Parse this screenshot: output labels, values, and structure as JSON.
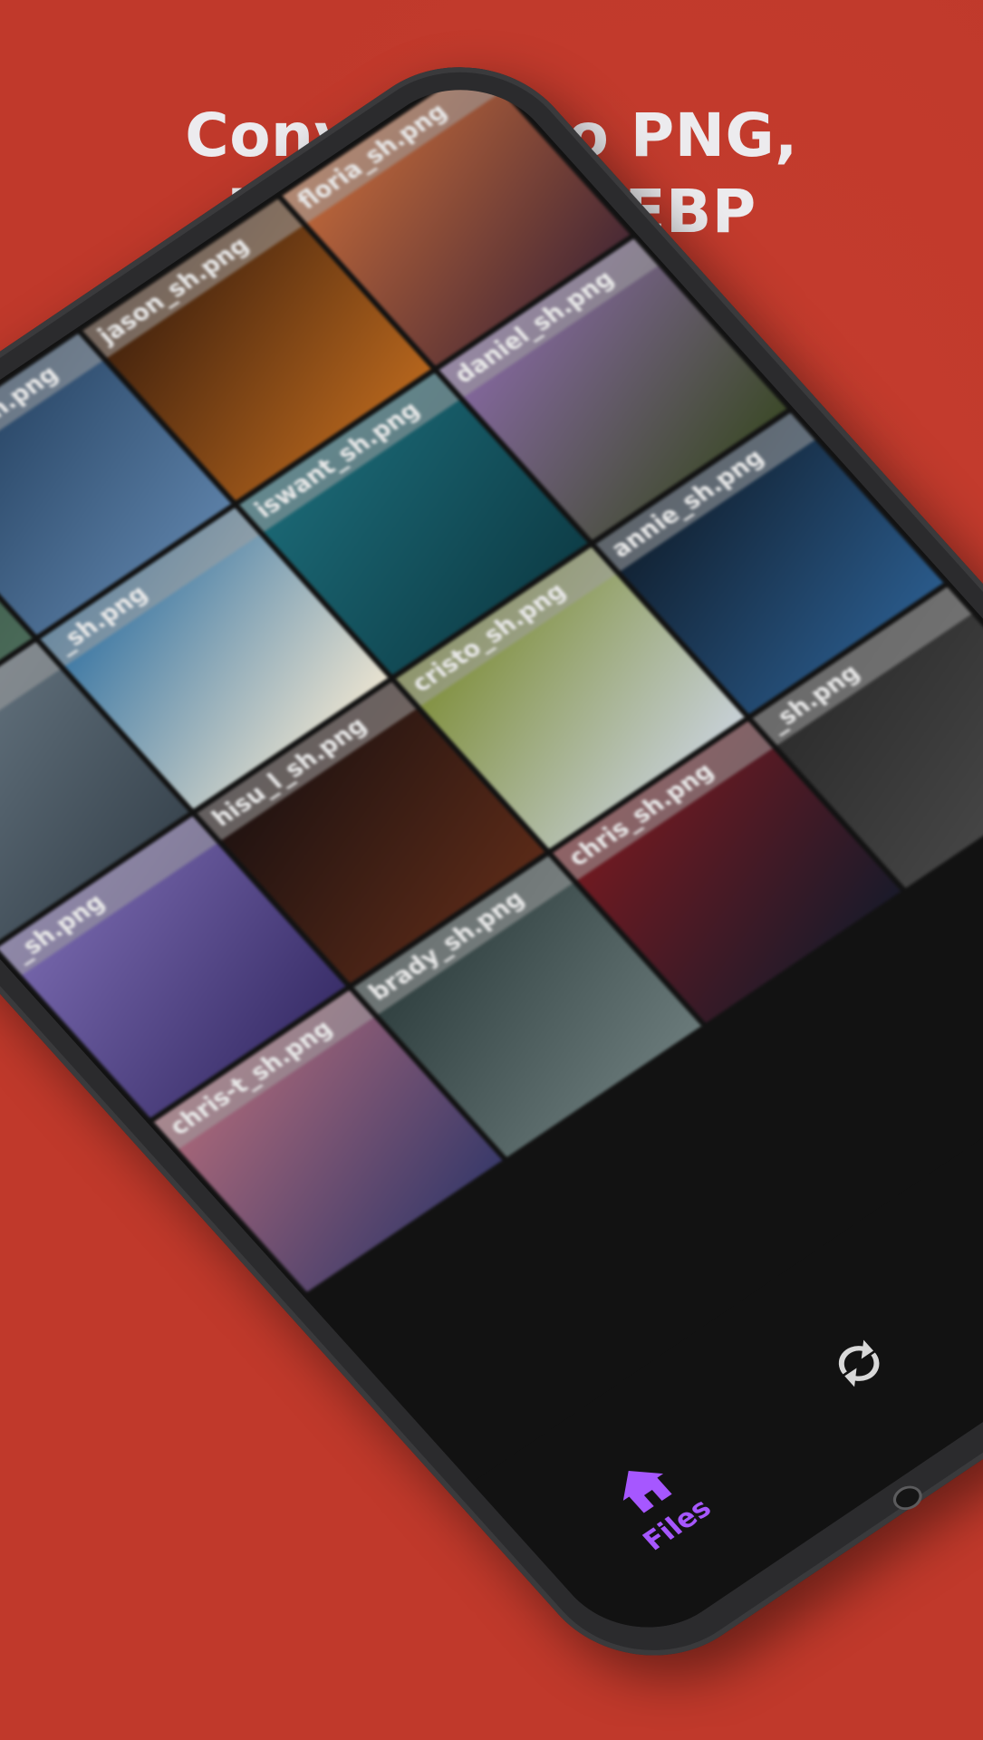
{
  "headline": {
    "line1": "Convert into PNG,",
    "line2": "JPG, PDF, WEBP"
  },
  "colors": {
    "background": "#c0392b",
    "headline_text": "#ecebee",
    "active_nav": "#a657ff",
    "screen": "#121212"
  },
  "gallery": {
    "tiles": [
      {
        "label": "_sh.png",
        "colors": [
          "#2f4a3c",
          "#4a6a58"
        ]
      },
      {
        "label": "nate-r_sh.png",
        "colors": [
          "#1f3b5a",
          "#5b7fa6"
        ]
      },
      {
        "label": "jason_sh.png",
        "colors": [
          "#3a1d0c",
          "#b5651d"
        ]
      },
      {
        "label": "floria_sh.png",
        "colors": [
          "#c46a3a",
          "#4a2a35"
        ]
      },
      {
        "label": "_sh.png",
        "colors": [
          "#6a7a86",
          "#3a4650"
        ]
      },
      {
        "label": "_sh.png",
        "colors": [
          "#2d6ea0",
          "#e8e2d0"
        ]
      },
      {
        "label": "iswant_sh.png",
        "colors": [
          "#1c6b78",
          "#0e3e48"
        ]
      },
      {
        "label": "daniel_sh.png",
        "colors": [
          "#8a6aa8",
          "#3d4a2a"
        ]
      },
      {
        "label": "_sh.png",
        "colors": [
          "#7a6ab0",
          "#3a2f6a"
        ]
      },
      {
        "label": "hisu_l_sh.png",
        "colors": [
          "#1a1010",
          "#5a2a18"
        ]
      },
      {
        "label": "cristo_sh.png",
        "colors": [
          "#7a8a30",
          "#c7d0d6"
        ]
      },
      {
        "label": "annie_sh.png",
        "colors": [
          "#0f1c2a",
          "#2a5a8a"
        ]
      },
      {
        "label": "chris-t_sh.png",
        "colors": [
          "#b06a7a",
          "#3a3a6a"
        ]
      },
      {
        "label": "brady_sh.png",
        "colors": [
          "#2a3a3a",
          "#6a7a7a"
        ]
      },
      {
        "label": "chris_sh.png",
        "colors": [
          "#7a1a20",
          "#1a1a2a"
        ]
      },
      {
        "label": "_sh.png",
        "colors": [
          "#2a2a2a",
          "#4a4a4a"
        ]
      }
    ]
  },
  "bottom_nav": {
    "files_label": "Files",
    "convert_icon": "convert-icon",
    "favorites_icon": "heart-icon",
    "settings_icon": "gear-icon"
  }
}
